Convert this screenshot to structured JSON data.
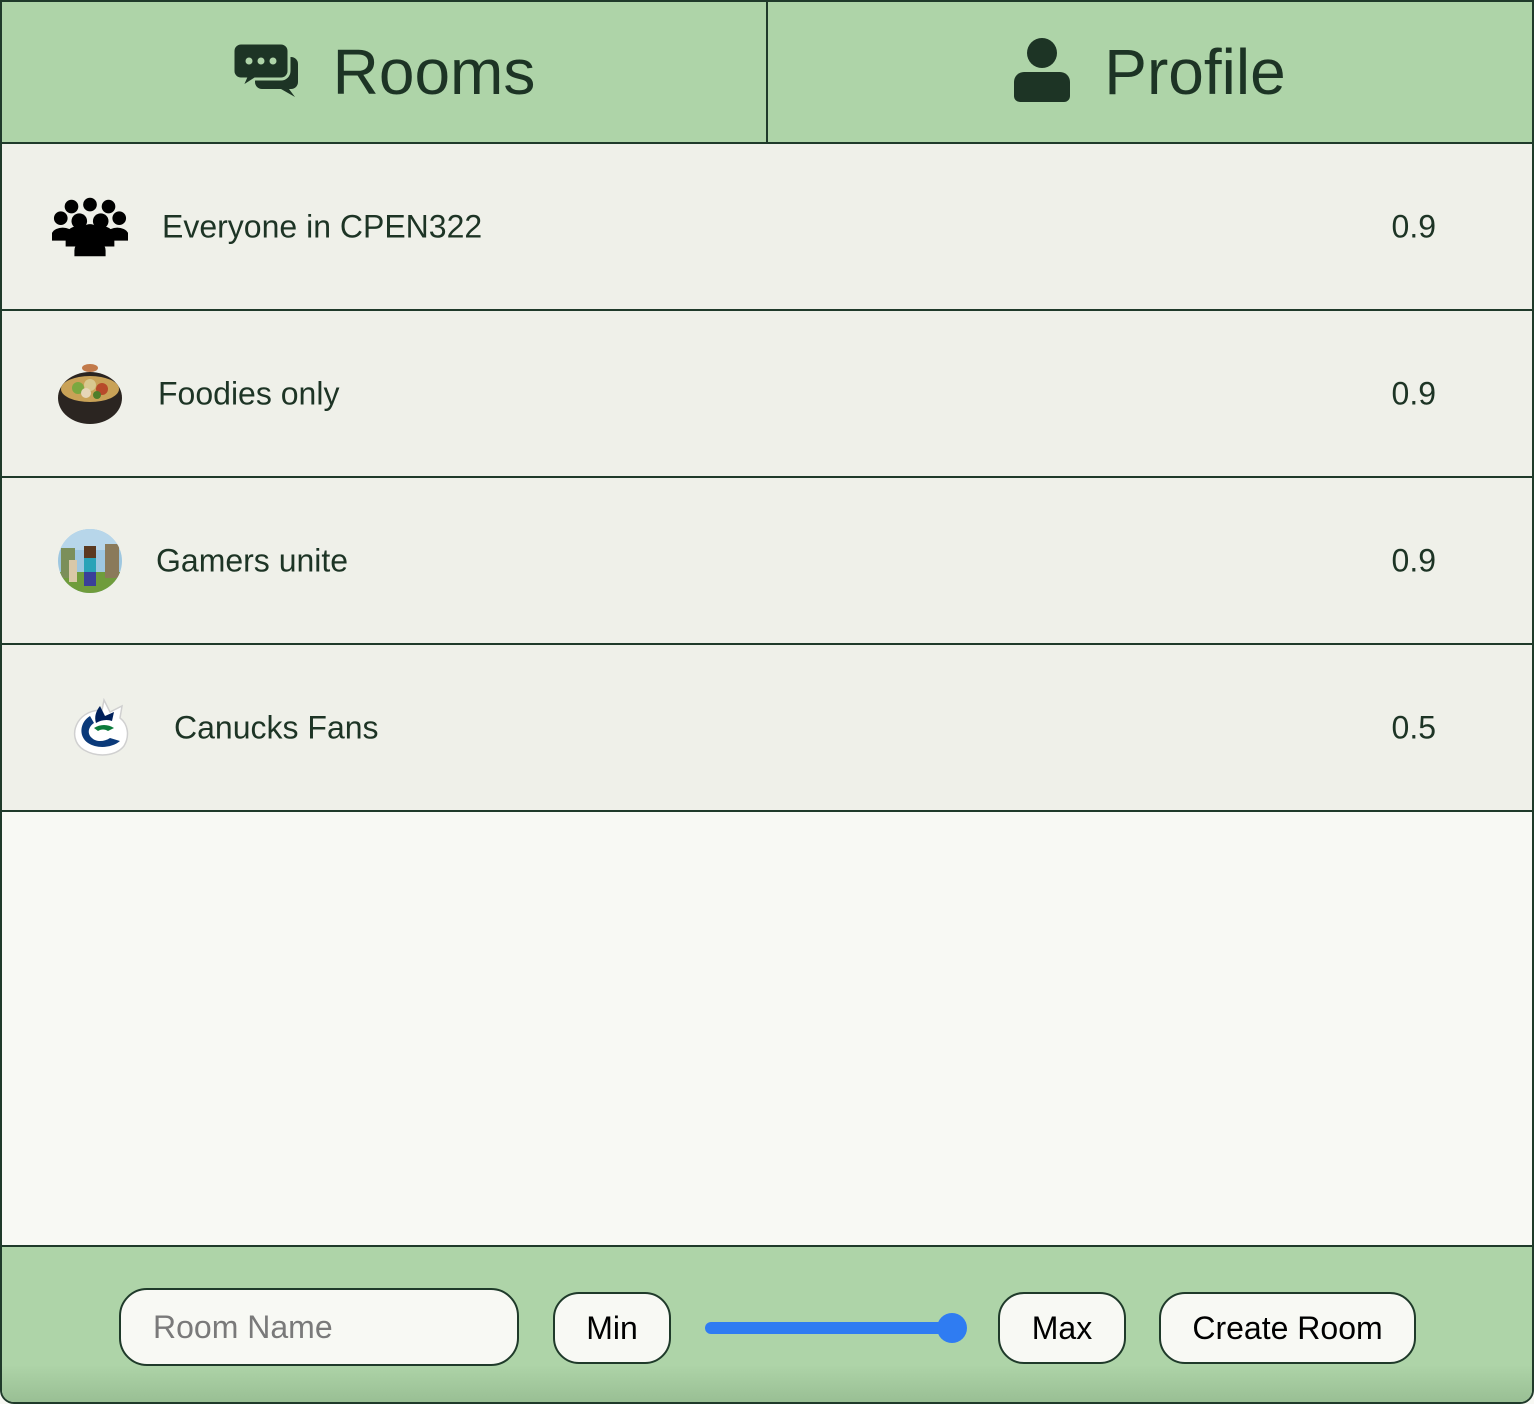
{
  "tabs": [
    {
      "label": "Rooms",
      "icon": "chat-bubbles-icon"
    },
    {
      "label": "Profile",
      "icon": "user-icon"
    }
  ],
  "rooms": [
    {
      "name": "Everyone in CPEN322",
      "score": "0.9",
      "icon": "group-icon"
    },
    {
      "name": "Foodies only",
      "score": "0.9",
      "icon": "food-bowl-image"
    },
    {
      "name": "Gamers unite",
      "score": "0.9",
      "icon": "minecraft-image"
    },
    {
      "name": "Canucks Fans",
      "score": "0.5",
      "icon": "canucks-logo"
    }
  ],
  "footer": {
    "room_name_placeholder": "Room Name",
    "room_name_value": "",
    "min_label": "Min",
    "max_label": "Max",
    "create_label": "Create Room",
    "slider_value": 1.0
  },
  "colors": {
    "header_bg": "#aed4a8",
    "row_bg": "#eff0e9",
    "text": "#1d3425",
    "slider_accent": "#2f7cf2"
  }
}
